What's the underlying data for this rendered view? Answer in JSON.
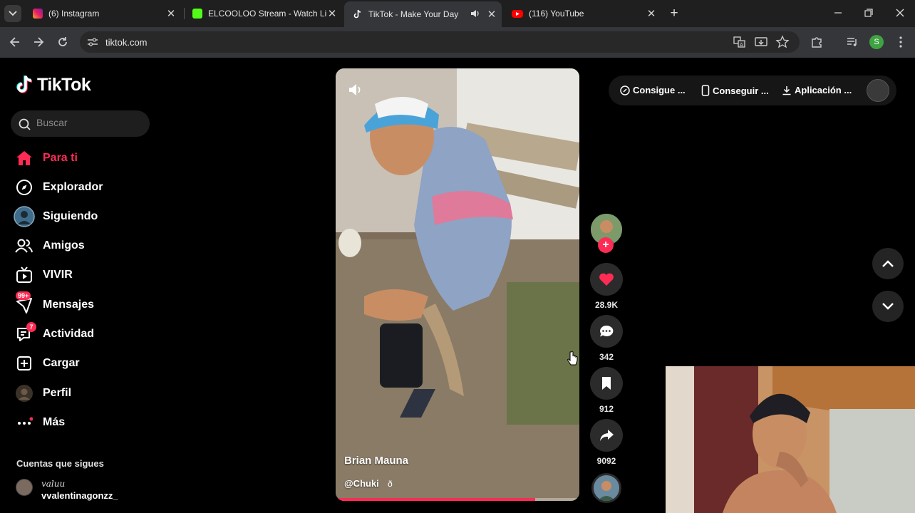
{
  "browser": {
    "tabs": [
      {
        "title": "(6) Instagram",
        "favicon": "instagram-icon",
        "active": false
      },
      {
        "title": "ELCOOLOO Stream - Watch Live",
        "favicon": "kick-icon",
        "active": false
      },
      {
        "title": "TikTok - Make Your Day",
        "favicon": "tiktok-icon",
        "active": true,
        "audio": true
      },
      {
        "title": "(116) YouTube",
        "favicon": "youtube-icon",
        "active": false
      }
    ],
    "url": "tiktok.com",
    "profile_initial": "S"
  },
  "tiktok": {
    "brand": "TikTok",
    "search_placeholder": "Buscar",
    "nav": [
      {
        "label": "Para ti",
        "icon": "home-icon",
        "active": true
      },
      {
        "label": "Explorador",
        "icon": "compass-icon"
      },
      {
        "label": "Siguiendo",
        "icon": "following-avatar-icon"
      },
      {
        "label": "Amigos",
        "icon": "friends-icon"
      },
      {
        "label": "VIVIR",
        "icon": "live-tv-icon"
      },
      {
        "label": "Mensajes",
        "icon": "messages-icon",
        "badge": "99+"
      },
      {
        "label": "Actividad",
        "icon": "activity-icon",
        "badge": "7"
      },
      {
        "label": "Cargar",
        "icon": "upload-icon"
      },
      {
        "label": "Perfil",
        "icon": "profile-avatar-icon"
      },
      {
        "label": "Más",
        "icon": "more-icon"
      }
    ],
    "following_title": "Cuentas que sigues",
    "followed_account": {
      "signature": "valuu",
      "username": "vvalentinagonzz_"
    },
    "header_buttons": [
      "Consigue ...",
      "Conseguir ...",
      "Aplicación ..."
    ]
  },
  "video": {
    "author": "Brian Mauna",
    "handle": "@Chuki",
    "handle_extra": "ð",
    "progress": 0.818
  },
  "actions": {
    "likes": "28.9K",
    "comments": "342",
    "saves": "912",
    "shares": "9092"
  },
  "colors": {
    "accent": "#fe2c55",
    "background": "#000000",
    "chrome": "#35363a"
  }
}
